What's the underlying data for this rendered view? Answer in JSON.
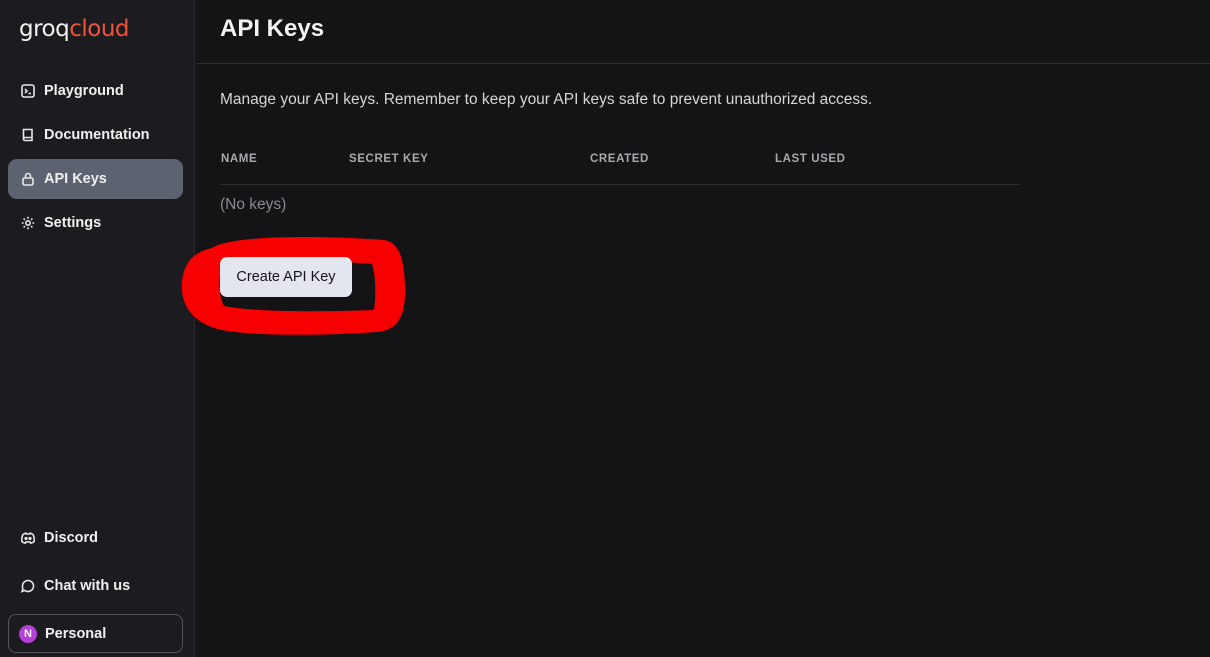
{
  "brand": {
    "part1": "groq",
    "part2": "cloud"
  },
  "sidebar": {
    "items": [
      {
        "label": "Playground",
        "icon": "terminal-icon"
      },
      {
        "label": "Documentation",
        "icon": "book-icon"
      },
      {
        "label": "API Keys",
        "icon": "lock-icon",
        "active": true
      },
      {
        "label": "Settings",
        "icon": "gear-icon"
      }
    ],
    "bottom": [
      {
        "label": "Discord",
        "icon": "discord-icon"
      },
      {
        "label": "Chat with us",
        "icon": "chat-bubble-icon"
      }
    ],
    "account": {
      "initial": "N",
      "label": "Personal",
      "avatar_color": "#b43fd6"
    }
  },
  "main": {
    "title": "API Keys",
    "description": "Manage your API keys. Remember to keep your API keys safe to prevent unauthorized access.",
    "table": {
      "columns": [
        "NAME",
        "SECRET KEY",
        "CREATED",
        "LAST USED"
      ],
      "empty_text": "(No keys)"
    },
    "create_button": "Create API Key"
  },
  "colors": {
    "accent": "#f0533a",
    "active_nav": "#5d6270",
    "annotation": "#ff0000"
  }
}
